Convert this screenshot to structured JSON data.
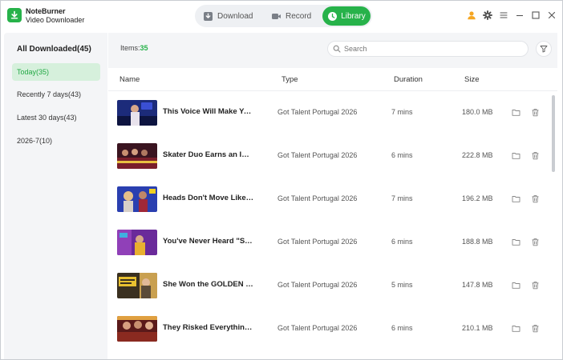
{
  "app": {
    "name_line1": "NoteBurner",
    "name_line2": "Video Downloader"
  },
  "colors": {
    "accent": "#27b24a",
    "user_icon": "#f5a623"
  },
  "nav": {
    "tabs": [
      {
        "label": "Download",
        "icon": "download-icon"
      },
      {
        "label": "Record",
        "icon": "video-camera-icon"
      },
      {
        "label": "Library",
        "icon": "clock-icon",
        "active": true
      }
    ]
  },
  "sidebar": {
    "header": "All Downloaded(45)",
    "items": [
      {
        "label": "Today(35)",
        "active": true
      },
      {
        "label": "Recently 7 days(43)"
      },
      {
        "label": "Latest 30 days(43)"
      },
      {
        "label": "2026-7(10)"
      }
    ]
  },
  "toolbar": {
    "items_label": "Items:",
    "items_count": "35",
    "search_placeholder": "Search"
  },
  "table": {
    "columns": [
      "Name",
      "Type",
      "Duration",
      "Size"
    ],
    "rows": [
      {
        "name": "This Voice Will Make Yo...",
        "type": "Got Talent Portugal 2026",
        "duration": "7 mins",
        "size": "180.0 MB"
      },
      {
        "name": "Skater Duo Earns an INS...",
        "type": "Got Talent Portugal 2026",
        "duration": "6 mins",
        "size": "222.8 MB"
      },
      {
        "name": "Heads Don't Move Like T...",
        "type": "Got Talent Portugal 2026",
        "duration": "7 mins",
        "size": "196.2 MB"
      },
      {
        "name": "You've Never Heard \"Sk...",
        "type": "Got Talent Portugal 2026",
        "duration": "6 mins",
        "size": "188.8 MB"
      },
      {
        "name": "She Won the GOLDEN BU...",
        "type": "Got Talent Portugal 2026",
        "duration": "5 mins",
        "size": "147.8 MB"
      },
      {
        "name": "They Risked Everything....",
        "type": "Got Talent Portugal 2026",
        "duration": "6 mins",
        "size": "210.1 MB"
      }
    ]
  }
}
